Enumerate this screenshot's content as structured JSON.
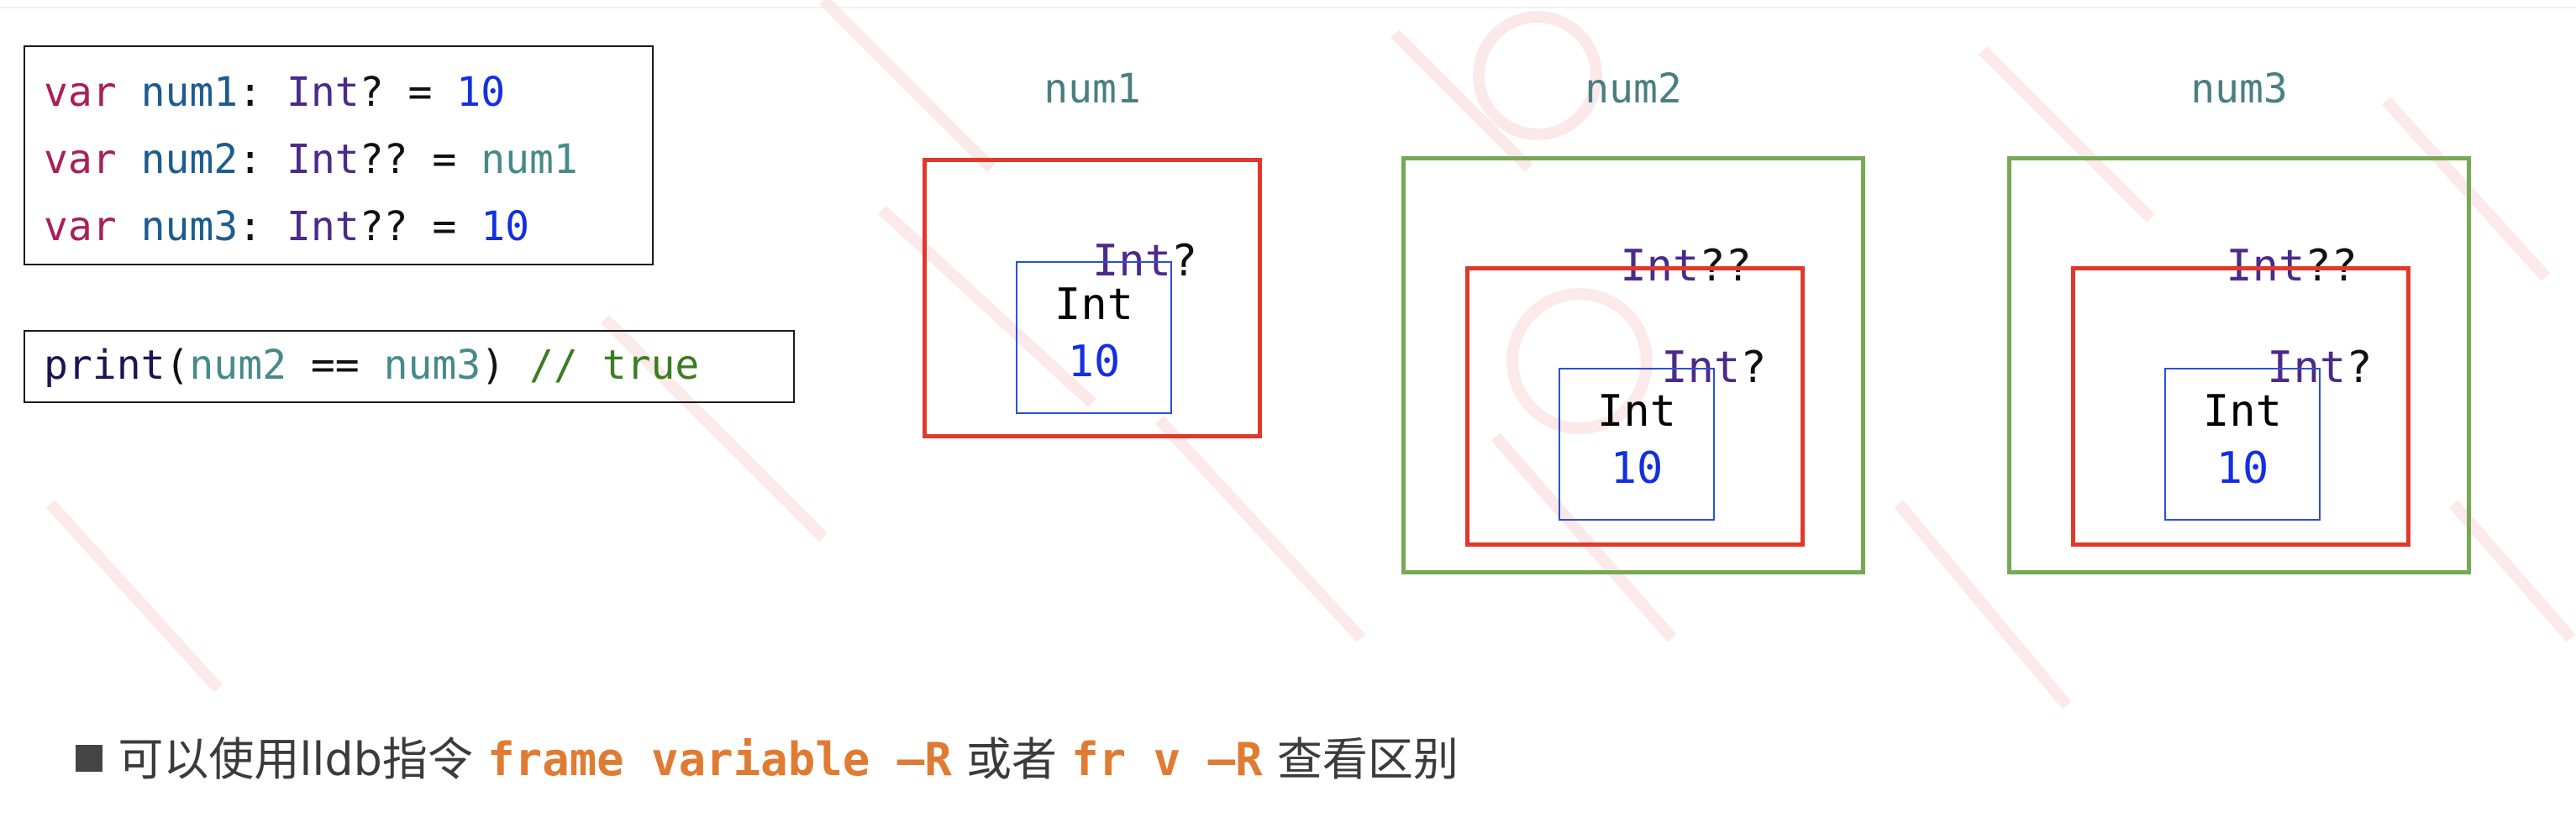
{
  "code": {
    "decl_lines": [
      [
        {
          "t": "var",
          "c": "kw"
        },
        {
          "t": " ",
          "c": "op"
        },
        {
          "t": "num1",
          "c": "id"
        },
        {
          "t": ": ",
          "c": "op"
        },
        {
          "t": "Int",
          "c": "ty"
        },
        {
          "t": "? = ",
          "c": "op"
        },
        {
          "t": "10",
          "c": "num"
        }
      ],
      [
        {
          "t": "var",
          "c": "kw"
        },
        {
          "t": " ",
          "c": "op"
        },
        {
          "t": "num2",
          "c": "id"
        },
        {
          "t": ": ",
          "c": "op"
        },
        {
          "t": "Int",
          "c": "ty"
        },
        {
          "t": "?? = ",
          "c": "op"
        },
        {
          "t": "num1",
          "c": "ref"
        }
      ],
      [
        {
          "t": "var",
          "c": "kw"
        },
        {
          "t": " ",
          "c": "op"
        },
        {
          "t": "num3",
          "c": "id"
        },
        {
          "t": ": ",
          "c": "op"
        },
        {
          "t": "Int",
          "c": "ty"
        },
        {
          "t": "?? = ",
          "c": "op"
        },
        {
          "t": "10",
          "c": "num"
        }
      ]
    ],
    "print_line": [
      {
        "t": "print",
        "c": "fn"
      },
      {
        "t": "(",
        "c": "op"
      },
      {
        "t": "num2",
        "c": "ref"
      },
      {
        "t": " == ",
        "c": "op"
      },
      {
        "t": "num3",
        "c": "ref"
      },
      {
        "t": ")",
        "c": "op"
      },
      {
        "t": " // true",
        "c": "cm"
      }
    ]
  },
  "diagram": {
    "num1": {
      "title": "num1",
      "outer_type": "Int",
      "outer_suffix": "?",
      "inner_type": "Int",
      "inner_value": "10"
    },
    "num2": {
      "title": "num2",
      "outer_type": "Int",
      "outer_suffix": "??",
      "mid_type": "Int",
      "mid_suffix": "?",
      "inner_type": "Int",
      "inner_value": "10"
    },
    "num3": {
      "title": "num3",
      "outer_type": "Int",
      "outer_suffix": "??",
      "mid_type": "Int",
      "mid_suffix": "?",
      "inner_type": "Int",
      "inner_value": "10"
    }
  },
  "note": {
    "prefix": "可以使用lldb指令 ",
    "cmd1": "frame variable –R",
    "middle": " 或者 ",
    "cmd2": "fr v –R",
    "suffix": " 查看区别"
  },
  "colors": {
    "keyword": "#a8205c",
    "identifier": "#1d5c8f",
    "type": "#4b2a8a",
    "number": "#1230e0",
    "reference": "#468a89",
    "comment": "#3b7d20",
    "outer_box": "#77a955",
    "optional_box": "#e0392b",
    "value_box": "#2b50d6",
    "command": "#e07b33"
  }
}
